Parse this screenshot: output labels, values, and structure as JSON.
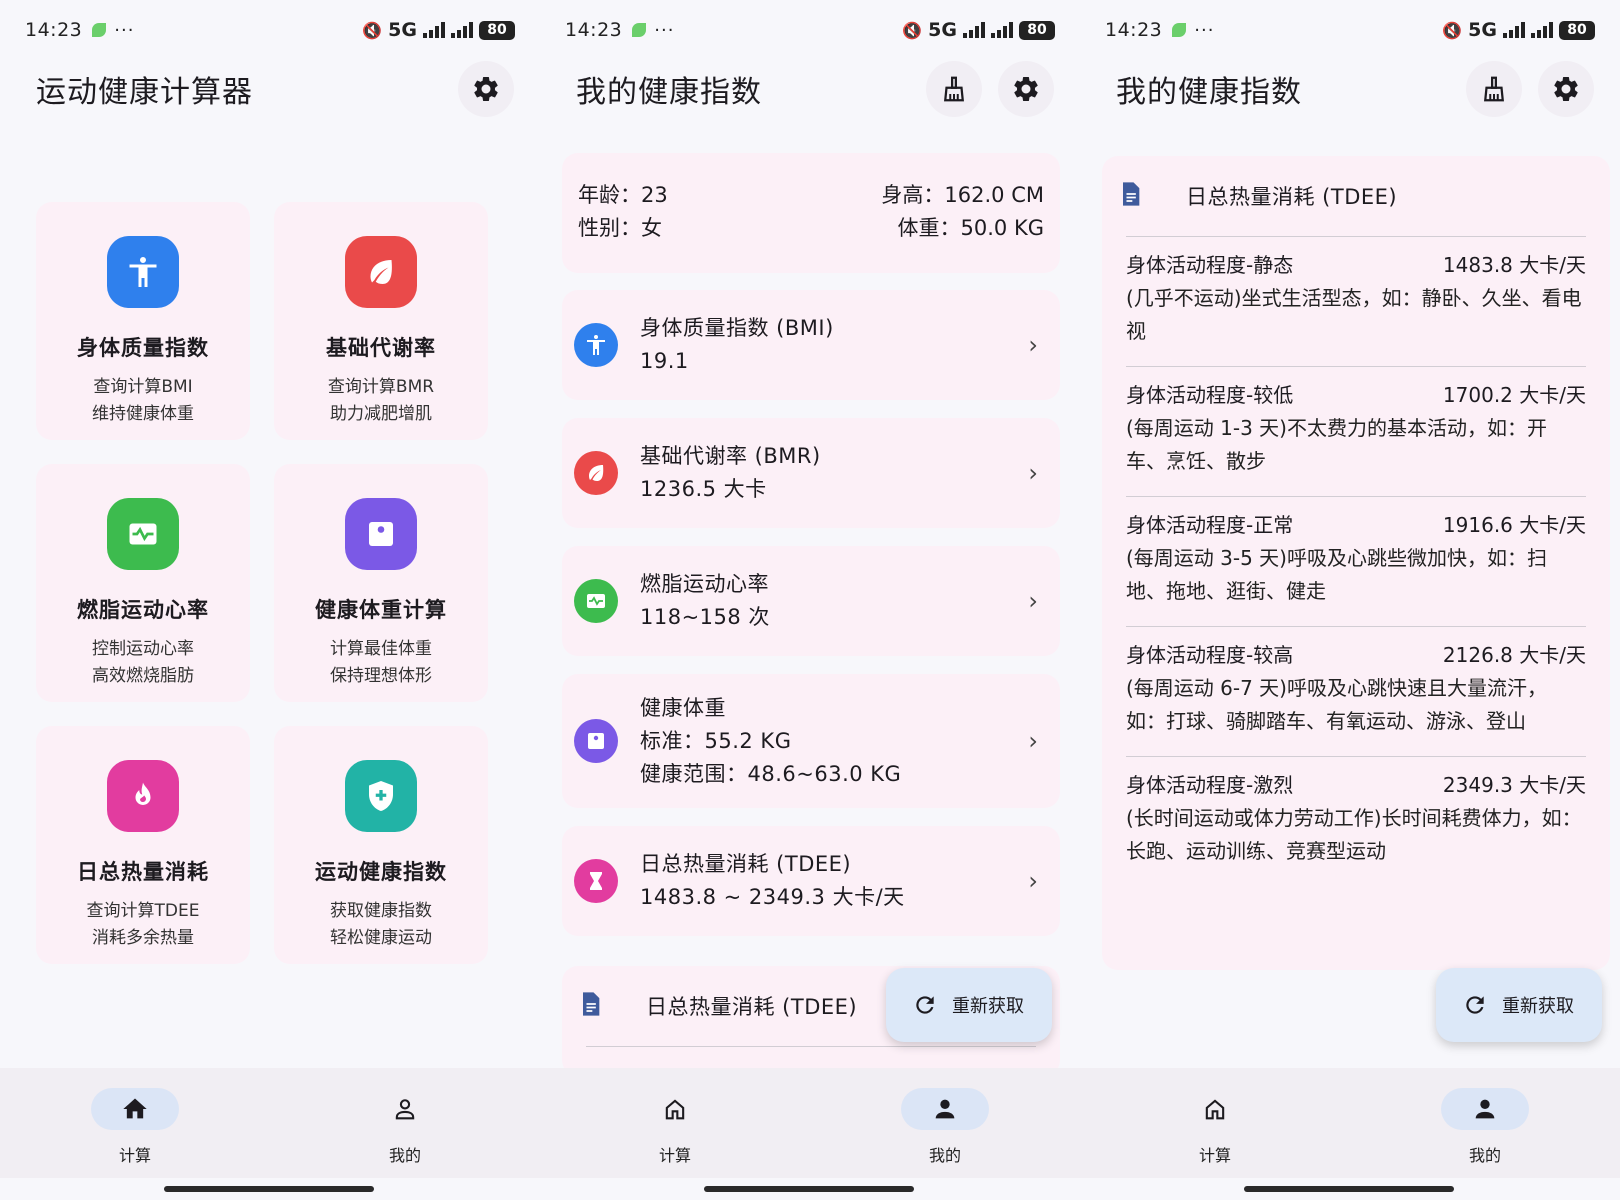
{
  "status_bar": {
    "time": "14:23",
    "dots": "···",
    "network": "5G",
    "battery": "80"
  },
  "screen1": {
    "title": "运动健康计算器",
    "cards": [
      {
        "title": "身体质量指数",
        "line1": "查询计算BMI",
        "line2": "维持健康体重",
        "color": "#2f80ed",
        "icon": "accessibility-icon"
      },
      {
        "title": "基础代谢率",
        "line1": "查询计算BMR",
        "line2": "助力减肥增肌",
        "color": "#ea4a4a",
        "icon": "leaf-icon"
      },
      {
        "title": "燃脂运动心率",
        "line1": "控制运动心率",
        "line2": "高效燃烧脂肪",
        "color": "#3dbb4e",
        "icon": "heartbeat-icon"
      },
      {
        "title": "健康体重计算",
        "line1": "计算最佳体重",
        "line2": "保持理想体形",
        "color": "#7b59e6",
        "icon": "scale-icon"
      },
      {
        "title": "日总热量消耗",
        "line1": "查询计算TDEE",
        "line2": "消耗多余热量",
        "color": "#e23c9f",
        "icon": "flame-icon"
      },
      {
        "title": "运动健康指数",
        "line1": "获取健康指数",
        "line2": "轻松健康运动",
        "color": "#22b3a6",
        "icon": "shield-plus-icon"
      }
    ]
  },
  "nav": {
    "calc": "计算",
    "mine": "我的"
  },
  "screen2": {
    "title": "我的健康指数",
    "info": {
      "age": "年龄：23",
      "height": "身高：162.0 CM",
      "gender": "性别：女",
      "weight": "体重：50.0 KG"
    },
    "rows": [
      {
        "line1": "身体质量指数 (BMI)",
        "line2": "19.1"
      },
      {
        "line1": "基础代谢率 (BMR)",
        "line2": "1236.5 大卡"
      },
      {
        "line1": "燃脂运动心率",
        "line2": "118~158 次"
      },
      {
        "line1": "健康体重",
        "line2": "标准：55.2 KG",
        "line3": "健康范围：48.6~63.0 KG"
      },
      {
        "line1": "日总热量消耗 (TDEE)",
        "line2": "1483.8 ~ 2349.3 大卡/天"
      }
    ],
    "tdee_header": "日总热量消耗 (TDEE)",
    "fab_label": "重新获取"
  },
  "screen3": {
    "title": "我的健康指数",
    "tdee_header": "日总热量消耗 (TDEE)",
    "levels": [
      {
        "name": "身体活动程度-静态",
        "value": "1483.8 大卡/天",
        "desc": "(几乎不运动)坐式生活型态，如：静卧、久坐、看电视"
      },
      {
        "name": "身体活动程度-较低",
        "value": "1700.2 大卡/天",
        "desc": "(每周运动 1-3 天)不太费力的基本活动，如：开车、烹饪、散步"
      },
      {
        "name": "身体活动程度-正常",
        "value": "1916.6 大卡/天",
        "desc": "(每周运动 3-5 天)呼吸及心跳些微加快，如：扫地、拖地、逛街、健走"
      },
      {
        "name": "身体活动程度-较高",
        "value": "2126.8 大卡/天",
        "desc": "(每周运动 6-7 天)呼吸及心跳快速且大量流汗，如：打球、骑脚踏车、有氧运动、游泳、登山"
      },
      {
        "name": "身体活动程度-激烈",
        "value": "2349.3 大卡/天",
        "desc": "(长时间运动或体力劳动工作)长时间耗费体力，如：长跑、运动训练、竞赛型运动"
      }
    ],
    "fab_label": "重新获取"
  }
}
